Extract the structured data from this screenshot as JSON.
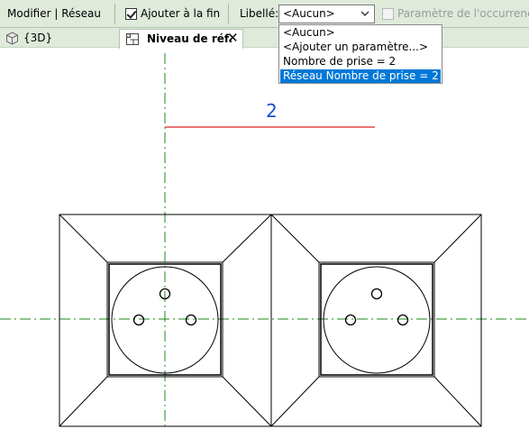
{
  "ribbon": {
    "context_label": "Modifier | Réseau",
    "add_to_end_label": "Ajouter à la fin",
    "add_to_end_checked": true,
    "label_field_label": "Libellé:",
    "label_value": "<Aucun>",
    "instance_param_label": "Paramètre de l'occurrence",
    "instance_param_checked": false
  },
  "dropdown": {
    "options": [
      "<Aucun>",
      "<Ajouter un paramètre...>",
      "Nombre de prise = 2",
      "Réseau Nombre de prise = 2"
    ],
    "selected_index": 3
  },
  "tabs": [
    {
      "label": "{3D}",
      "icon": "cube-3d-icon",
      "active": false
    },
    {
      "label": "Niveau de réf.",
      "icon": "floor-plan-icon",
      "active": true,
      "close": "✕"
    }
  ],
  "drawing": {
    "dimension_value": "2",
    "colors": {
      "centerline": "#1b8a1b",
      "dimension_line": "#e02020",
      "dimension_text": "#1b4dcf",
      "geometry": "#000000"
    }
  }
}
